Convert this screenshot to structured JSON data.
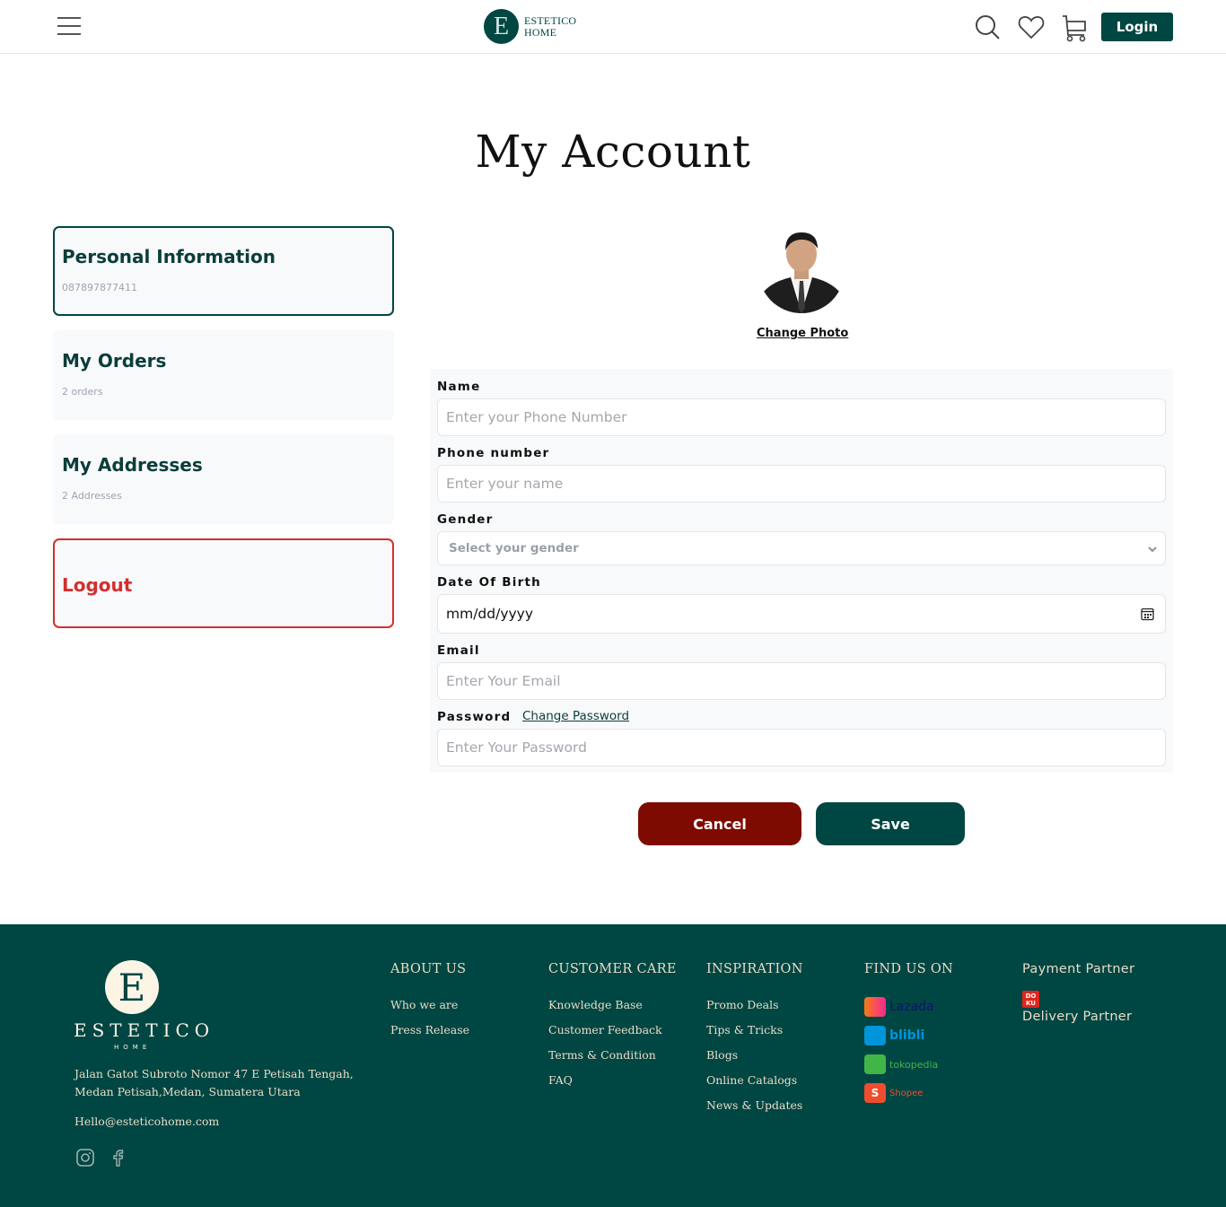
{
  "header": {
    "logo": {
      "mark": "E",
      "line1": "ESTETICO",
      "line2": "HOME"
    },
    "icons": [
      "menu-icon",
      "search-icon",
      "heart-icon",
      "cart-icon"
    ],
    "login_label": "Login"
  },
  "page": {
    "title": "My Account"
  },
  "sidebar": {
    "items": [
      {
        "title": "Personal Information",
        "subtitle": "087897877411",
        "active": true
      },
      {
        "title": "My Orders",
        "subtitle": "2 orders"
      },
      {
        "title": "My Addresses",
        "subtitle": "2 Addresses"
      },
      {
        "title": "Logout"
      }
    ]
  },
  "profile": {
    "change_photo_label": "Change Photo"
  },
  "form": {
    "name": {
      "label": "Name",
      "placeholder": "Enter your Phone Number",
      "value": ""
    },
    "phone": {
      "label": "Phone number",
      "placeholder": "Enter your name",
      "value": ""
    },
    "gender": {
      "label": "Gender",
      "selected": "Select your gender"
    },
    "dob": {
      "label": "Date Of Birth",
      "value": "mm/dd/yyyy"
    },
    "email": {
      "label": "Email",
      "placeholder": "Enter Your Email",
      "value": ""
    },
    "password": {
      "label": "Password",
      "change_link": "Change Password",
      "placeholder": "Enter Your Password",
      "value": ""
    }
  },
  "actions": {
    "cancel_label": "Cancel",
    "save_label": "Save"
  },
  "colors": {
    "brand": "#004643",
    "cancel": "#7e0b02",
    "logout": "#d32f2f",
    "footer_text": "#e8dcc6"
  },
  "footer": {
    "brand": {
      "mark": "E",
      "name": "ESTETICO",
      "sub": "HOME"
    },
    "address": "Jalan Gatot Subroto Nomor 47 E Petisah Tengah, Medan Petisah,Medan, Sumatera Utara",
    "email": "Hello@esteticohome.com",
    "social": [
      "instagram-icon",
      "facebook-icon"
    ],
    "columns": [
      {
        "heading": "ABOUT US",
        "links": [
          "Who we are",
          "Press Release"
        ]
      },
      {
        "heading": "CUSTOMER CARE",
        "links": [
          "Knowledge Base",
          "Customer Feedback",
          "Terms & Condition",
          "FAQ"
        ]
      },
      {
        "heading": "INSPIRATION",
        "links": [
          "Promo Deals",
          "Tips & Tricks",
          "Blogs",
          "Online Catalogs",
          "News & Updates"
        ]
      }
    ],
    "find_us": {
      "heading": "FIND US ON",
      "marketplaces": [
        {
          "name": "Lazada",
          "color": "#0f146d"
        },
        {
          "name": "blibli",
          "color": "#0095da"
        },
        {
          "name": "tokopedia",
          "color": "#42b549"
        },
        {
          "name": "Shopee",
          "color": "#ee4d2d"
        }
      ]
    },
    "payment_partner": {
      "heading": "Payment Partner",
      "logo": "DOKU"
    },
    "delivery_partner": {
      "heading": "Delivery Partner"
    }
  }
}
